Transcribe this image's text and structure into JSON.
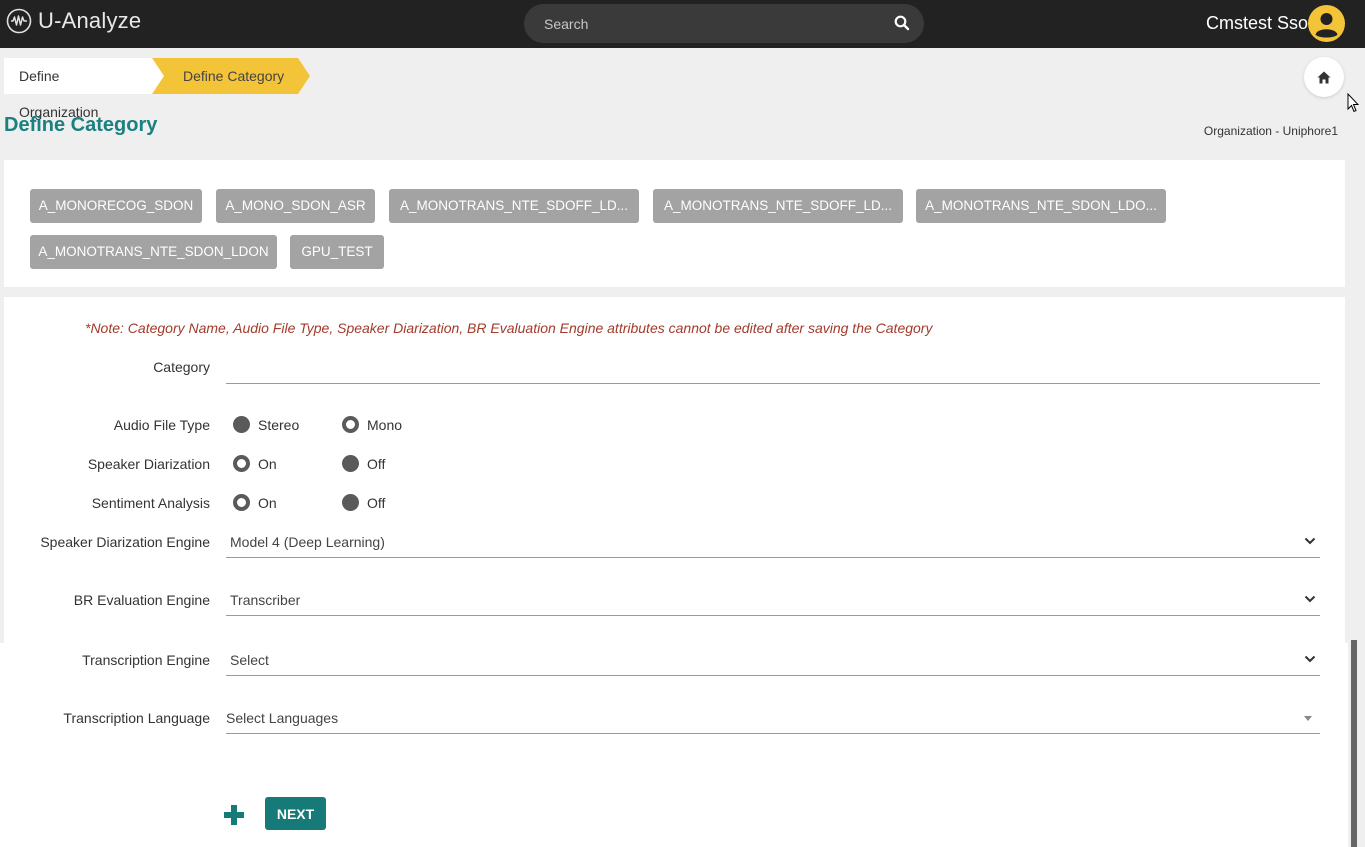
{
  "app": {
    "title": "U-Analyze"
  },
  "search": {
    "placeholder": "Search"
  },
  "user": {
    "name": "Cmstest Sso"
  },
  "breadcrumb": {
    "items": [
      "Define Organization",
      "Define Category"
    ]
  },
  "page": {
    "title": "Define Category",
    "organization": "Organization - Uniphore1"
  },
  "categories": [
    "A_MONORECOG_SDON",
    "A_MONO_SDON_ASR",
    "A_MONOTRANS_NTE_SDOFF_LD...",
    "A_MONOTRANS_NTE_SDOFF_LD...",
    "A_MONOTRANS_NTE_SDON_LDO...",
    "A_MONOTRANS_NTE_SDON_LDON",
    "GPU_TEST"
  ],
  "form": {
    "note": "*Note: Category Name, Audio File Type, Speaker Diarization, BR Evaluation Engine attributes cannot be edited after saving the Category",
    "category": {
      "label": "Category",
      "value": ""
    },
    "audio_file_type": {
      "label": "Audio File Type",
      "options": [
        "Stereo",
        "Mono"
      ],
      "selected": "Mono"
    },
    "speaker_diarization": {
      "label": "Speaker Diarization",
      "options": [
        "On",
        "Off"
      ],
      "selected": "On"
    },
    "sentiment_analysis": {
      "label": "Sentiment Analysis",
      "options": [
        "On",
        "Off"
      ],
      "selected": "On"
    },
    "speaker_diarization_engine": {
      "label": "Speaker Diarization Engine",
      "value": "Model 4 (Deep Learning)"
    },
    "br_evaluation_engine": {
      "label": "BR Evaluation Engine",
      "value": "Transcriber"
    },
    "transcription_engine": {
      "label": "Transcription Engine",
      "value": "Select"
    },
    "transcription_language": {
      "label": "Transcription Language",
      "value": "Select Languages"
    }
  },
  "actions": {
    "next_label": "NEXT"
  },
  "colors": {
    "accent": "#167a78",
    "title": "#1a8080",
    "breadcrumb_active": "#f3c338",
    "chip": "#a3a3a3",
    "note": "#a33a2a",
    "avatar": "#f3c338"
  }
}
